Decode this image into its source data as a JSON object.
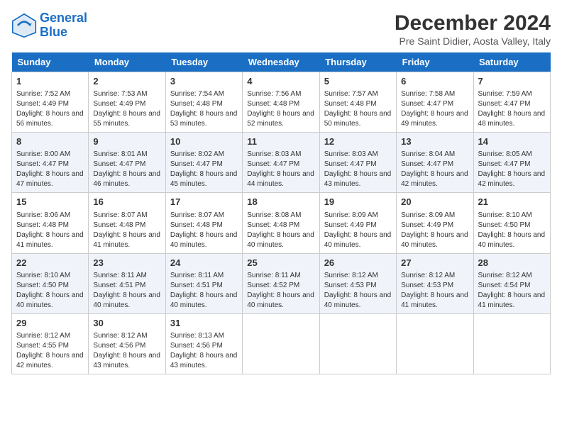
{
  "logo": {
    "line1": "General",
    "line2": "Blue"
  },
  "title": "December 2024",
  "subtitle": "Pre Saint Didier, Aosta Valley, Italy",
  "headers": [
    "Sunday",
    "Monday",
    "Tuesday",
    "Wednesday",
    "Thursday",
    "Friday",
    "Saturday"
  ],
  "weeks": [
    [
      {
        "day": "1",
        "sunrise": "Sunrise: 7:52 AM",
        "sunset": "Sunset: 4:49 PM",
        "daylight": "Daylight: 8 hours and 56 minutes."
      },
      {
        "day": "2",
        "sunrise": "Sunrise: 7:53 AM",
        "sunset": "Sunset: 4:49 PM",
        "daylight": "Daylight: 8 hours and 55 minutes."
      },
      {
        "day": "3",
        "sunrise": "Sunrise: 7:54 AM",
        "sunset": "Sunset: 4:48 PM",
        "daylight": "Daylight: 8 hours and 53 minutes."
      },
      {
        "day": "4",
        "sunrise": "Sunrise: 7:56 AM",
        "sunset": "Sunset: 4:48 PM",
        "daylight": "Daylight: 8 hours and 52 minutes."
      },
      {
        "day": "5",
        "sunrise": "Sunrise: 7:57 AM",
        "sunset": "Sunset: 4:48 PM",
        "daylight": "Daylight: 8 hours and 50 minutes."
      },
      {
        "day": "6",
        "sunrise": "Sunrise: 7:58 AM",
        "sunset": "Sunset: 4:47 PM",
        "daylight": "Daylight: 8 hours and 49 minutes."
      },
      {
        "day": "7",
        "sunrise": "Sunrise: 7:59 AM",
        "sunset": "Sunset: 4:47 PM",
        "daylight": "Daylight: 8 hours and 48 minutes."
      }
    ],
    [
      {
        "day": "8",
        "sunrise": "Sunrise: 8:00 AM",
        "sunset": "Sunset: 4:47 PM",
        "daylight": "Daylight: 8 hours and 47 minutes."
      },
      {
        "day": "9",
        "sunrise": "Sunrise: 8:01 AM",
        "sunset": "Sunset: 4:47 PM",
        "daylight": "Daylight: 8 hours and 46 minutes."
      },
      {
        "day": "10",
        "sunrise": "Sunrise: 8:02 AM",
        "sunset": "Sunset: 4:47 PM",
        "daylight": "Daylight: 8 hours and 45 minutes."
      },
      {
        "day": "11",
        "sunrise": "Sunrise: 8:03 AM",
        "sunset": "Sunset: 4:47 PM",
        "daylight": "Daylight: 8 hours and 44 minutes."
      },
      {
        "day": "12",
        "sunrise": "Sunrise: 8:03 AM",
        "sunset": "Sunset: 4:47 PM",
        "daylight": "Daylight: 8 hours and 43 minutes."
      },
      {
        "day": "13",
        "sunrise": "Sunrise: 8:04 AM",
        "sunset": "Sunset: 4:47 PM",
        "daylight": "Daylight: 8 hours and 42 minutes."
      },
      {
        "day": "14",
        "sunrise": "Sunrise: 8:05 AM",
        "sunset": "Sunset: 4:47 PM",
        "daylight": "Daylight: 8 hours and 42 minutes."
      }
    ],
    [
      {
        "day": "15",
        "sunrise": "Sunrise: 8:06 AM",
        "sunset": "Sunset: 4:48 PM",
        "daylight": "Daylight: 8 hours and 41 minutes."
      },
      {
        "day": "16",
        "sunrise": "Sunrise: 8:07 AM",
        "sunset": "Sunset: 4:48 PM",
        "daylight": "Daylight: 8 hours and 41 minutes."
      },
      {
        "day": "17",
        "sunrise": "Sunrise: 8:07 AM",
        "sunset": "Sunset: 4:48 PM",
        "daylight": "Daylight: 8 hours and 40 minutes."
      },
      {
        "day": "18",
        "sunrise": "Sunrise: 8:08 AM",
        "sunset": "Sunset: 4:48 PM",
        "daylight": "Daylight: 8 hours and 40 minutes."
      },
      {
        "day": "19",
        "sunrise": "Sunrise: 8:09 AM",
        "sunset": "Sunset: 4:49 PM",
        "daylight": "Daylight: 8 hours and 40 minutes."
      },
      {
        "day": "20",
        "sunrise": "Sunrise: 8:09 AM",
        "sunset": "Sunset: 4:49 PM",
        "daylight": "Daylight: 8 hours and 40 minutes."
      },
      {
        "day": "21",
        "sunrise": "Sunrise: 8:10 AM",
        "sunset": "Sunset: 4:50 PM",
        "daylight": "Daylight: 8 hours and 40 minutes."
      }
    ],
    [
      {
        "day": "22",
        "sunrise": "Sunrise: 8:10 AM",
        "sunset": "Sunset: 4:50 PM",
        "daylight": "Daylight: 8 hours and 40 minutes."
      },
      {
        "day": "23",
        "sunrise": "Sunrise: 8:11 AM",
        "sunset": "Sunset: 4:51 PM",
        "daylight": "Daylight: 8 hours and 40 minutes."
      },
      {
        "day": "24",
        "sunrise": "Sunrise: 8:11 AM",
        "sunset": "Sunset: 4:51 PM",
        "daylight": "Daylight: 8 hours and 40 minutes."
      },
      {
        "day": "25",
        "sunrise": "Sunrise: 8:11 AM",
        "sunset": "Sunset: 4:52 PM",
        "daylight": "Daylight: 8 hours and 40 minutes."
      },
      {
        "day": "26",
        "sunrise": "Sunrise: 8:12 AM",
        "sunset": "Sunset: 4:53 PM",
        "daylight": "Daylight: 8 hours and 40 minutes."
      },
      {
        "day": "27",
        "sunrise": "Sunrise: 8:12 AM",
        "sunset": "Sunset: 4:53 PM",
        "daylight": "Daylight: 8 hours and 41 minutes."
      },
      {
        "day": "28",
        "sunrise": "Sunrise: 8:12 AM",
        "sunset": "Sunset: 4:54 PM",
        "daylight": "Daylight: 8 hours and 41 minutes."
      }
    ],
    [
      {
        "day": "29",
        "sunrise": "Sunrise: 8:12 AM",
        "sunset": "Sunset: 4:55 PM",
        "daylight": "Daylight: 8 hours and 42 minutes."
      },
      {
        "day": "30",
        "sunrise": "Sunrise: 8:12 AM",
        "sunset": "Sunset: 4:56 PM",
        "daylight": "Daylight: 8 hours and 43 minutes."
      },
      {
        "day": "31",
        "sunrise": "Sunrise: 8:13 AM",
        "sunset": "Sunset: 4:56 PM",
        "daylight": "Daylight: 8 hours and 43 minutes."
      },
      null,
      null,
      null,
      null
    ]
  ]
}
